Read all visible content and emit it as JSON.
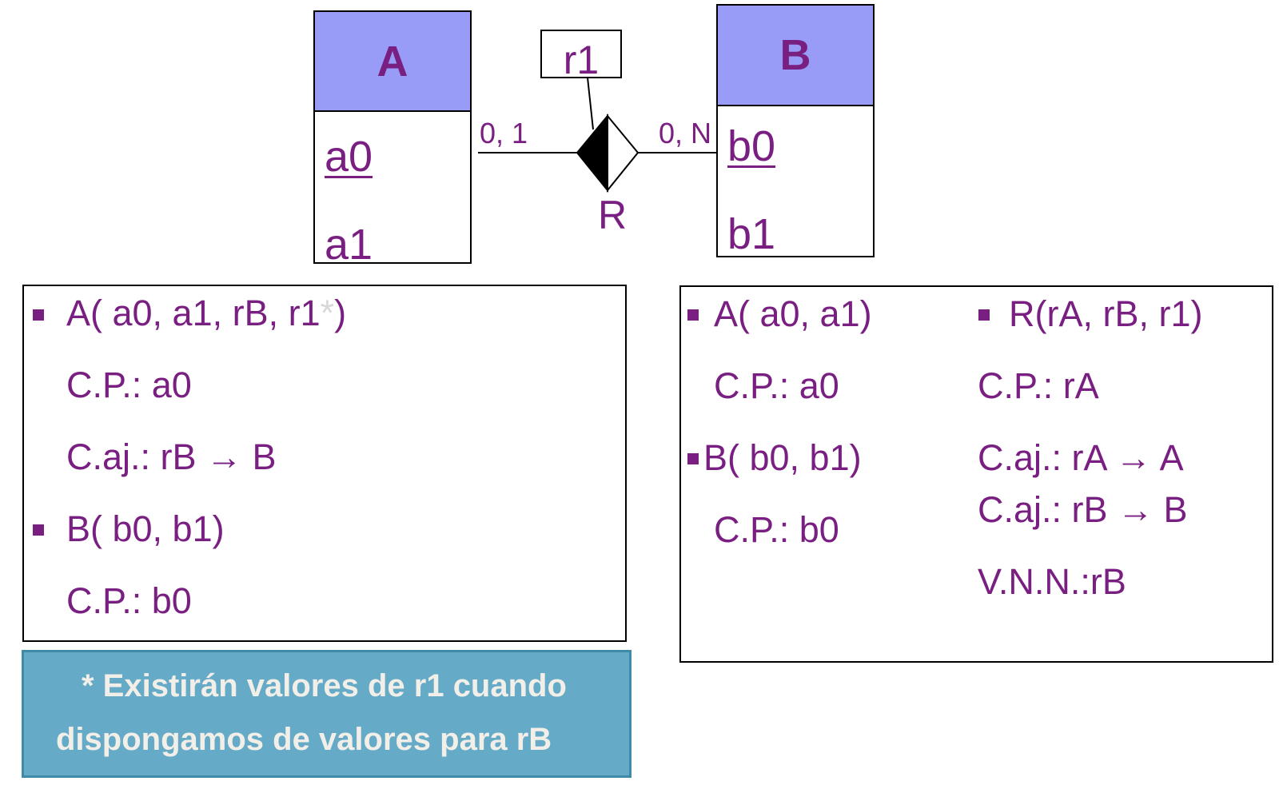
{
  "diagram": {
    "entity_a": {
      "name": "A",
      "attrs": [
        "a0",
        "a1"
      ]
    },
    "entity_b": {
      "name": "B",
      "attrs": [
        "b0",
        "b1"
      ]
    },
    "relationship": {
      "name": "R",
      "attribute": "r1",
      "card_a": "0, 1",
      "card_b": "0, N"
    }
  },
  "left_panel": {
    "a_prefix": "A( a0, a1, rB, r1",
    "a_star": "*",
    "a_suffix": ")",
    "a_pk": "C.P.: a0",
    "a_fk": "C.aj.: rB → B",
    "b_rel": "B( b0, b1)",
    "b_pk": "C.P.: b0"
  },
  "right_panel": {
    "a_rel": "A( a0, a1)",
    "a_pk": "C.P.: a0",
    "b_rel": "B( b0, b1)",
    "b_pk": "C.P.: b0",
    "r_rel": "R(rA, rB, r1)",
    "r_pk": "C.P.: rA",
    "r_fk1": "C.aj.: rA → A",
    "r_fk2": "C.aj.: rB → B",
    "r_vnn": "V.N.N.:rB"
  },
  "note": {
    "line1": "* Existirán valores de r1 cuando",
    "line2": "dispongamos de valores para rB"
  },
  "colors": {
    "text": "#7a1f82",
    "entity_header": "#999cf7",
    "note_bg": "#65aac7",
    "note_text": "#f2eee8"
  }
}
